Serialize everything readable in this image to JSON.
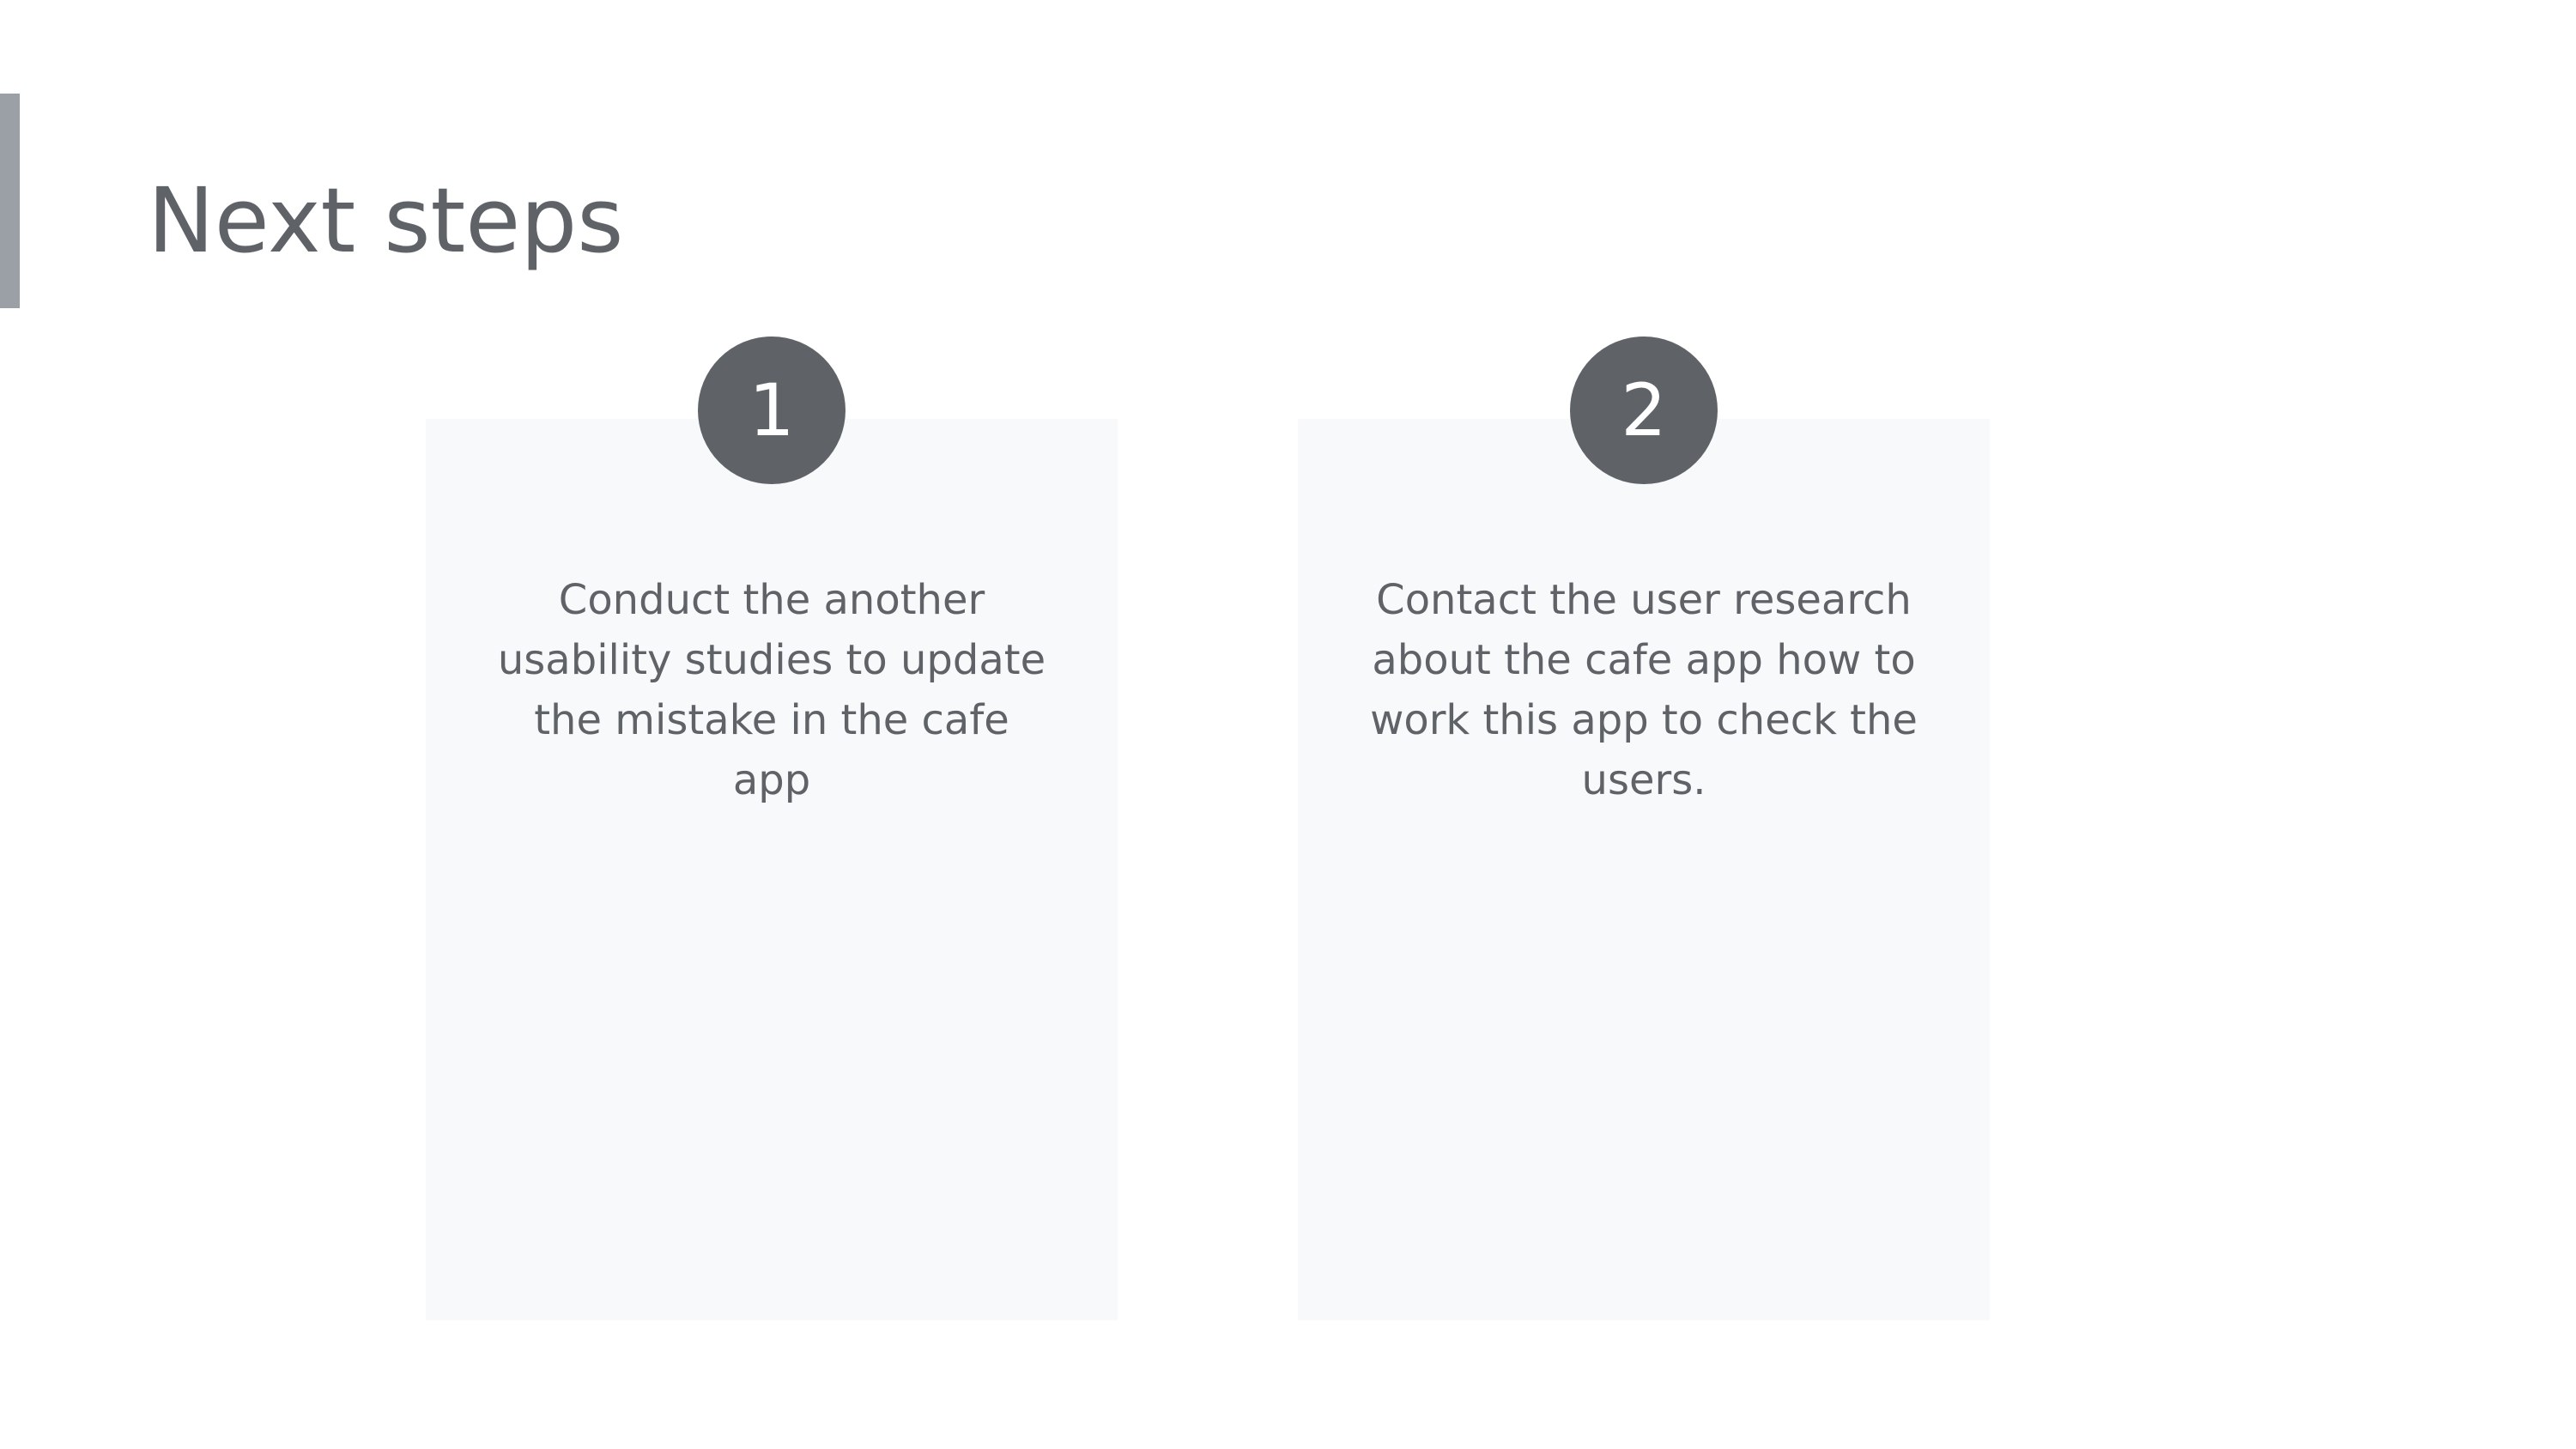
{
  "slide": {
    "title": "Next steps",
    "steps": [
      {
        "number": "1",
        "text": "Conduct the another usability studies to update the mistake in the cafe app"
      },
      {
        "number": "2",
        "text": "Contact the user research about the cafe app how to work this app to check the users."
      }
    ]
  },
  "colors": {
    "title": "#5f6368",
    "accent_bar": "#9aa0a6",
    "badge": "#5f6368",
    "card_background": "#f8f9fa",
    "background": "#ffffff"
  }
}
